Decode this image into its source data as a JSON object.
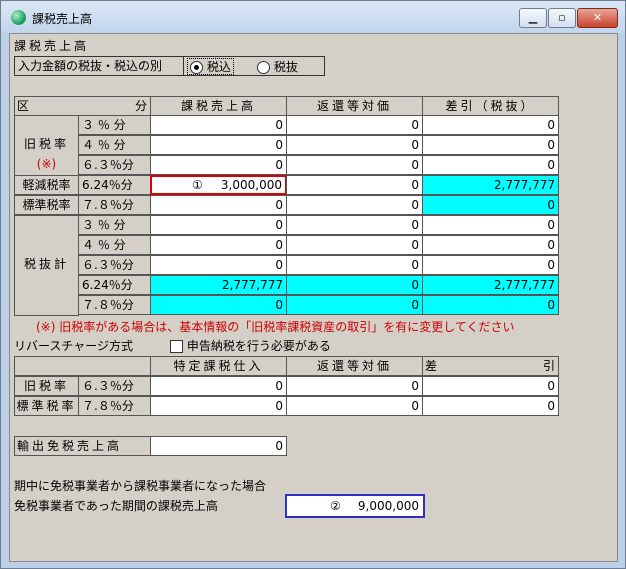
{
  "window": {
    "title": "課税売上高"
  },
  "top": {
    "section_title": "課税売上高",
    "tax_mode_label": "入力金額の税抜・税込の別",
    "opt_included": "税込",
    "opt_excluded": "税抜",
    "selected": "税込"
  },
  "table1": {
    "header": {
      "col0": "区",
      "col0b": "分",
      "col1": "課税売上高",
      "col2": "返還等対価",
      "col3": "差引（税抜）"
    },
    "group_old": {
      "label1": "旧税率",
      "label2": "(※)"
    },
    "group_reduced": "軽減税率",
    "group_standard": "標準税率",
    "group_excl": "税抜計",
    "rates": [
      "３ ％ 分",
      "４ ％ 分",
      "６.３％分",
      "6.24％分",
      "７.８％分",
      "３ ％ 分",
      "４ ％ 分",
      "６.３％分",
      "6.24％分",
      "７.８％分"
    ],
    "sales": [
      "0",
      "0",
      "0",
      "3,000,000",
      "0",
      "0",
      "0",
      "0",
      "2,777,777",
      "0"
    ],
    "returns": [
      "0",
      "0",
      "0",
      "0",
      "0",
      "0",
      "0",
      "0",
      "0",
      "0"
    ],
    "net": [
      "0",
      "0",
      "0",
      "2,777,777",
      "0",
      "0",
      "0",
      "0",
      "2,777,777",
      "0"
    ],
    "marker_sales": "①",
    "note": "(※) 旧税率がある場合は、基本情報の「旧税率課税資産の取引」を有に変更してください"
  },
  "reverse": {
    "title": "リバースチャージ方式",
    "checkbox_label": "申告納税を行う必要がある",
    "checked": false,
    "header": {
      "col1": "特定課税仕入",
      "col2": "返還等対価",
      "col3a": "差",
      "col3b": "引"
    },
    "rows": [
      {
        "label": "旧税率",
        "rate": "６.３％分",
        "v1": "0",
        "v2": "0",
        "v3": "0"
      },
      {
        "label": "標準税率",
        "rate": "７.８％分",
        "v1": "0",
        "v2": "0",
        "v3": "0"
      }
    ]
  },
  "export": {
    "label": "輸出免税売上高",
    "value": "0"
  },
  "exempt": {
    "line1": "期中に免税事業者から課税事業者になった場合",
    "line2": "免税事業者であった期間の課税売上高",
    "marker": "②",
    "value": "9,000,000"
  },
  "colors": {
    "cyan": "#00ffff",
    "red_border": "#e00000",
    "blue_border": "#3030c0",
    "note_red": "#d00000"
  }
}
